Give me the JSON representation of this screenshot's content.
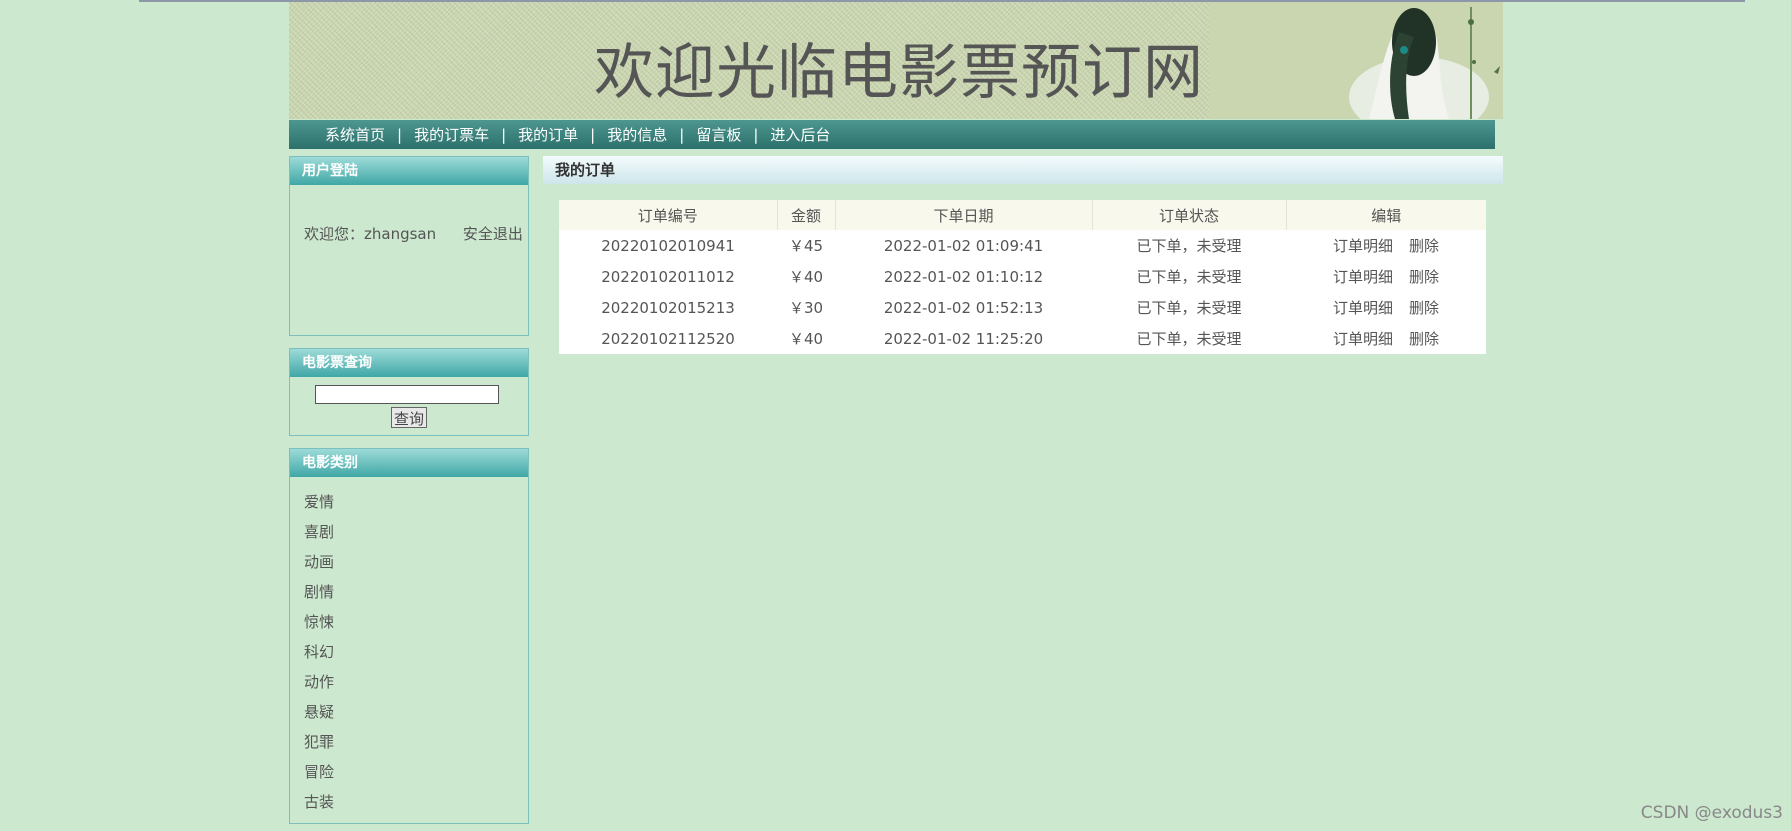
{
  "header": {
    "title": "欢迎光临电影票预订网"
  },
  "nav": {
    "items": [
      "系统首页",
      "我的订票车",
      "我的订单",
      "我的信息",
      "留言板",
      "进入后台"
    ],
    "separator": "|"
  },
  "login": {
    "heading": "用户登陆",
    "welcome": "欢迎您：zhangsan",
    "logout": "安全退出"
  },
  "search": {
    "heading": "电影票查询",
    "value": "",
    "button": "查询"
  },
  "categories": {
    "heading": "电影类别",
    "items": [
      "爱情",
      "喜剧",
      "动画",
      "剧情",
      "惊悚",
      "科幻",
      "动作",
      "悬疑",
      "犯罪",
      "冒险",
      "古装"
    ]
  },
  "main": {
    "heading": "我的订单",
    "columns": [
      "订单编号",
      "金额",
      "下单日期",
      "订单状态",
      "编辑"
    ],
    "rows": [
      {
        "id": "20220102010941",
        "amount": "￥45",
        "date": "2022-01-02 01:09:41",
        "status": "已下单，未受理",
        "detail": "订单明细",
        "delete": "删除"
      },
      {
        "id": "20220102011012",
        "amount": "￥40",
        "date": "2022-01-02 01:10:12",
        "status": "已下单，未受理",
        "detail": "订单明细",
        "delete": "删除"
      },
      {
        "id": "20220102015213",
        "amount": "￥30",
        "date": "2022-01-02 01:52:13",
        "status": "已下单，未受理",
        "detail": "订单明细",
        "delete": "删除"
      },
      {
        "id": "20220102112520",
        "amount": "￥40",
        "date": "2022-01-02 11:25:20",
        "status": "已下单，未受理",
        "detail": "订单明细",
        "delete": "删除"
      }
    ]
  },
  "watermark": "CSDN @exodus3",
  "colors": {
    "background": "#cce8cf",
    "nav": "#2c716b",
    "box_head": "#3fa7a6"
  }
}
